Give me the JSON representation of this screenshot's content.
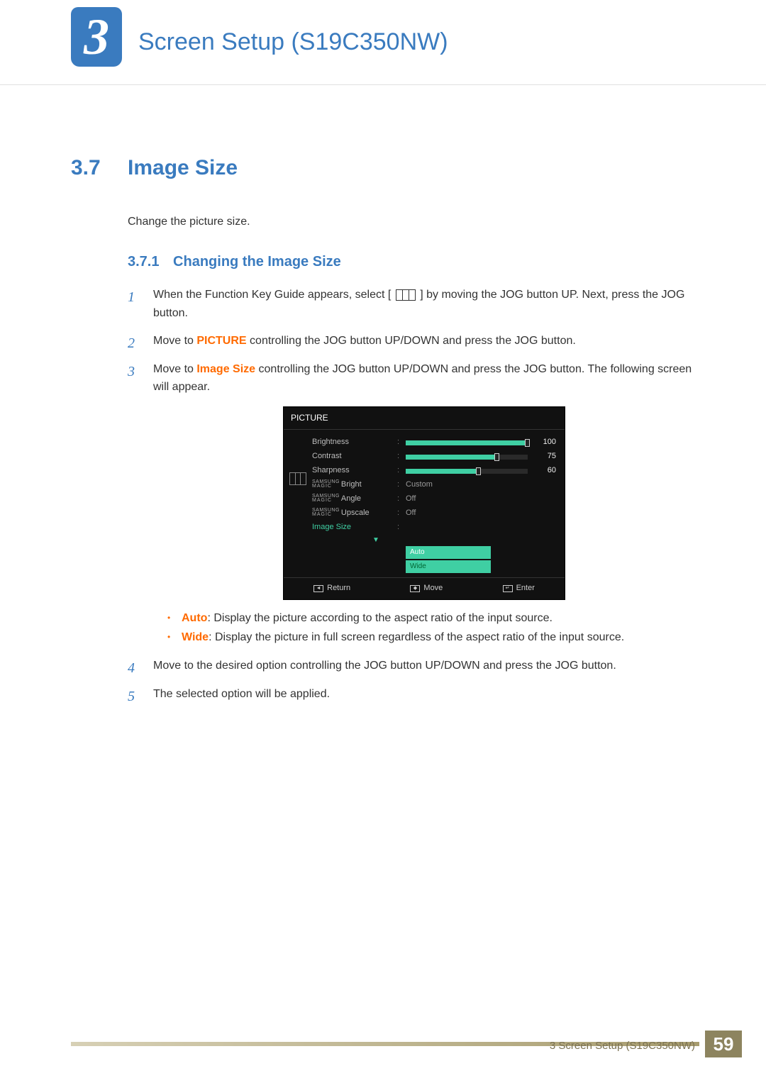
{
  "chapter": {
    "number": "3",
    "title": "Screen Setup (S19C350NW)"
  },
  "section": {
    "number": "3.7",
    "title": "Image Size",
    "intro": "Change the picture size."
  },
  "subsection": {
    "number": "3.7.1",
    "title": "Changing the Image Size"
  },
  "steps": {
    "s1a": "When the Function Key Guide appears, select [",
    "s1b": "] by moving the JOG button UP. Next, press the JOG button.",
    "s2a": "Move to ",
    "s2kw": "PICTURE",
    "s2b": " controlling the JOG button UP/DOWN and press the JOG button.",
    "s3a": "Move to ",
    "s3kw": "Image Size",
    "s3b": " controlling the JOG button UP/DOWN and press the JOG button. The following screen will appear.",
    "s4": "Move to the desired option controlling the JOG button UP/DOWN and press the JOG button.",
    "s5": "The selected option will be applied."
  },
  "options": {
    "auto_label": "Auto",
    "auto_desc": ": Display the picture according to the aspect ratio of the input source.",
    "wide_label": "Wide",
    "wide_desc": ": Display the picture in full screen regardless of the aspect ratio of the input source."
  },
  "osd": {
    "title": "PICTURE",
    "rows": [
      {
        "label": "Brightness",
        "type": "bar",
        "value": 100,
        "pct": 100
      },
      {
        "label": "Contrast",
        "type": "bar",
        "value": 75,
        "pct": 75
      },
      {
        "label": "Sharpness",
        "type": "bar",
        "value": 60,
        "pct": 60
      },
      {
        "label": "Bright",
        "type": "text",
        "value": "Custom",
        "magic": true
      },
      {
        "label": "Angle",
        "type": "text",
        "value": "Off",
        "magic": true
      },
      {
        "label": "Upscale",
        "type": "text",
        "value": "Off",
        "magic": true
      },
      {
        "label": "Image Size",
        "type": "dropdown",
        "highlight": true
      }
    ],
    "dropdown": [
      "Auto",
      "Wide"
    ],
    "footer": {
      "return": "Return",
      "move": "Move",
      "enter": "Enter"
    }
  },
  "footer": {
    "text": "3 Screen Setup (S19C350NW)",
    "page": "59"
  }
}
